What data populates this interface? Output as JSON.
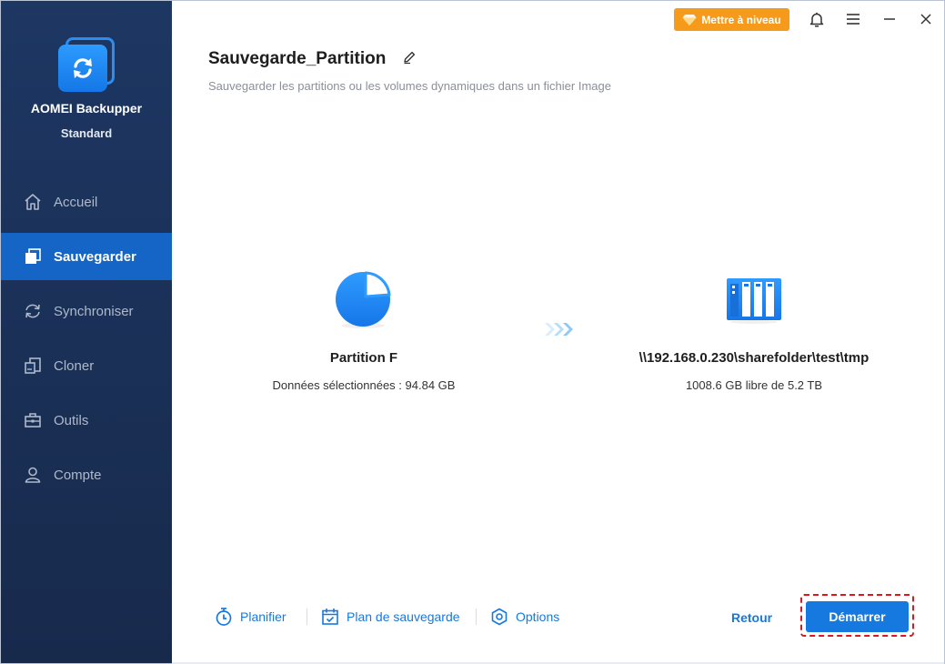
{
  "app": {
    "name": "AOMEI Backupper",
    "edition": "Standard"
  },
  "titlebar": {
    "upgrade_label": "Mettre à niveau",
    "icons": [
      "bell-icon",
      "menu-icon",
      "minimize-icon",
      "close-icon"
    ]
  },
  "sidebar": {
    "items": [
      {
        "label": "Accueil",
        "icon": "home-icon",
        "active": false
      },
      {
        "label": "Sauvegarder",
        "icon": "backup-icon",
        "active": true
      },
      {
        "label": "Synchroniser",
        "icon": "sync-icon",
        "active": false
      },
      {
        "label": "Cloner",
        "icon": "clone-icon",
        "active": false
      },
      {
        "label": "Outils",
        "icon": "toolbox-icon",
        "active": false
      },
      {
        "label": "Compte",
        "icon": "user-icon",
        "active": false
      }
    ]
  },
  "main": {
    "title": "Sauvegarde_Partition",
    "subtitle": "Sauvegarder les partitions ou les volumes dynamiques dans un fichier Image",
    "source": {
      "title": "Partition F",
      "info": "Données sélectionnées : 94.84 GB",
      "icon": "partition-pie-icon"
    },
    "destination": {
      "title": "\\\\192.168.0.230\\sharefolder\\test\\tmp",
      "info": "1008.6 GB libre de 5.2 TB",
      "icon": "nas-icon"
    }
  },
  "bottom": {
    "schedule_label": "Planifier",
    "plan_label": "Plan de sauvegarde",
    "options_label": "Options",
    "back_label": "Retour",
    "start_label": "Démarrer"
  },
  "colors": {
    "sidebar_bg": "#1d3763",
    "active_item": "#1565c6",
    "accent": "#1679e0",
    "upgrade": "#f59a1b",
    "highlight_outline": "#e0161f"
  }
}
